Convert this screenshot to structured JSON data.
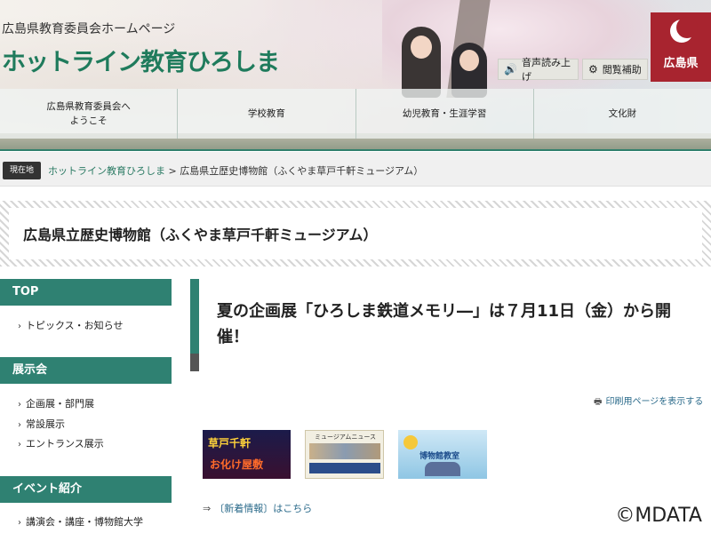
{
  "header": {
    "site_subtitle": "広島県教育委員会ホームページ",
    "site_title": "ホットライン教育ひろしま",
    "logo_text": "広島県",
    "utility": {
      "read_aloud": "音声読み上げ",
      "browse_assist": "閲覧補助"
    },
    "nav": [
      {
        "label": "広島県教育委員会へ\nようこそ"
      },
      {
        "label": "学校教育"
      },
      {
        "label": "幼児教育・生涯学習"
      },
      {
        "label": "文化財"
      }
    ]
  },
  "breadcrumb": {
    "label": "現在地",
    "home": "ホットライン教育ひろしま",
    "separator": ">",
    "current": "広島県立歴史博物館（ふくやま草戸千軒ミュージアム）"
  },
  "page_title": "広島県立歴史博物館（ふくやま草戸千軒ミュージアム）",
  "sidebar": {
    "sections": [
      {
        "heading": "TOP",
        "links": [
          "トピックス・お知らせ"
        ]
      },
      {
        "heading": "展示会",
        "links": [
          "企画展・部門展",
          "常設展示",
          "エントランス展示"
        ]
      },
      {
        "heading": "イベント紹介",
        "links": [
          "講演会・講座・博物館大学"
        ]
      }
    ]
  },
  "main": {
    "headline": "夏の企画展「ひろしま鉄道メモリ―」は７月11日（金）から開催！",
    "print_link": "印刷用ページを表示する",
    "thumbnails": [
      {
        "text1": "草戸千軒",
        "text2": "お化け屋敷"
      },
      {
        "text1": "ミュージアムニュース"
      },
      {
        "text1": "博物館教室"
      }
    ],
    "news_link": "〔新着情報〕はこちら"
  },
  "watermark": "©MDATA"
}
